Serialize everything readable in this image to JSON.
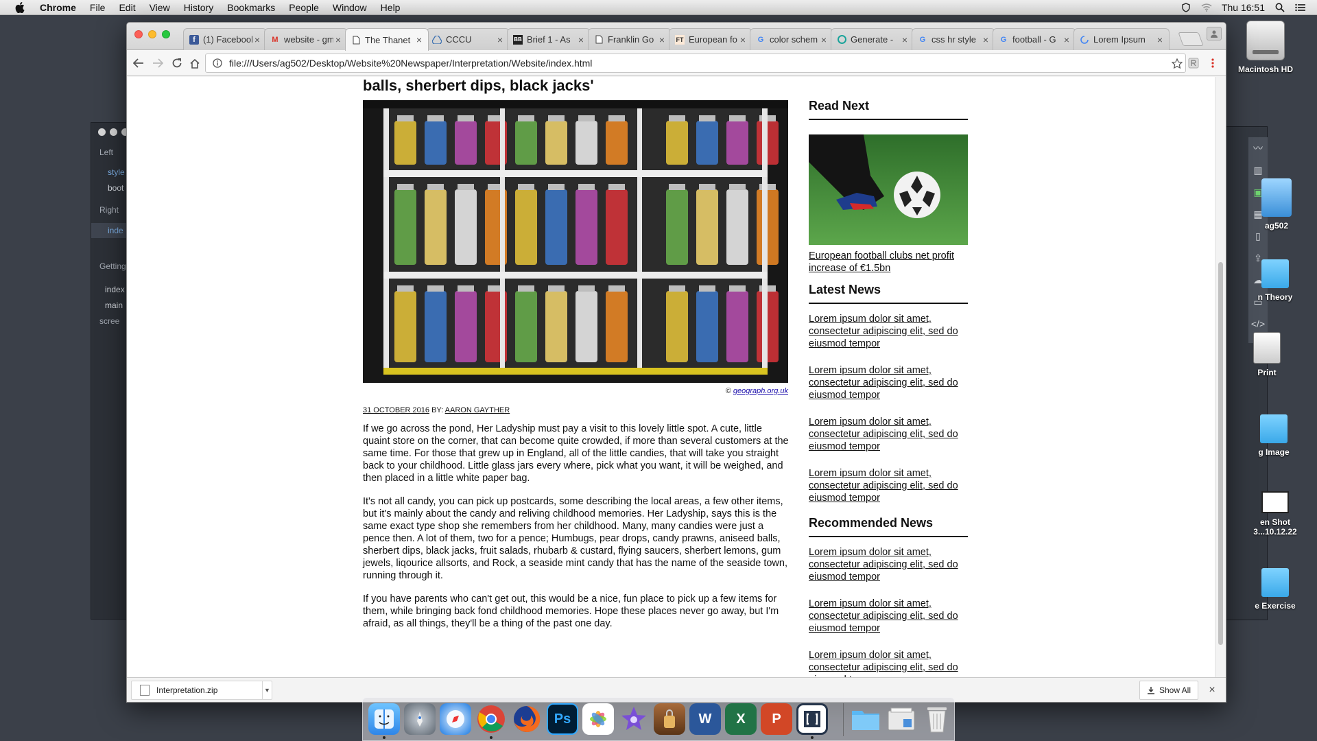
{
  "menubar": {
    "app": "Chrome",
    "items": [
      "File",
      "Edit",
      "View",
      "History",
      "Bookmarks",
      "People",
      "Window",
      "Help"
    ],
    "clock": "Thu 16:51"
  },
  "desktop": {
    "icons": [
      "Macintosh HD",
      "ag502",
      "n Theory",
      "Print",
      "g Image",
      "en Shot",
      "3...10.12.22",
      "e Exercise"
    ]
  },
  "editor": {
    "left_label": "Left",
    "left_items": [
      "style",
      "boot"
    ],
    "right_label": "Right",
    "right_item": "inde",
    "getting_label": "Getting",
    "files": [
      "index",
      "main",
      "scree"
    ]
  },
  "chrome": {
    "tabs": [
      {
        "title": "(1) Facebook",
        "icon": "facebook-icon"
      },
      {
        "title": "website - gmail",
        "icon": "gmail-icon"
      },
      {
        "title": "The Thanet",
        "icon": "page-icon"
      },
      {
        "title": "CCCU",
        "icon": "drive-icon"
      },
      {
        "title": "Brief 1 - As",
        "icon": "brief-icon"
      },
      {
        "title": "Franklin Go",
        "icon": "page-icon"
      },
      {
        "title": "European fo",
        "icon": "ft-icon"
      },
      {
        "title": "color schem",
        "icon": "google-icon"
      },
      {
        "title": "Generate - ",
        "icon": "generate-icon"
      },
      {
        "title": "css hr style",
        "icon": "google-icon"
      },
      {
        "title": "football - G",
        "icon": "google-icon"
      },
      {
        "title": "Lorem Ipsum",
        "icon": "loading-icon"
      }
    ],
    "active_tab_index": 2,
    "url": "file:///Users/ag502/Desktop/Website%20Newspaper/Interpretation/Website/index.html"
  },
  "article": {
    "headline_tail": "balls, sherbert dips, black jacks'",
    "credit_prefix": "©",
    "credit_link": "geograph.org.uk",
    "date": "31 OCTOBER 2016",
    "by_label": "BY:",
    "author": "AARON GAYTHER",
    "paragraphs": [
      "If we go across the pond, Her Ladyship must pay a visit to this lovely little spot. A cute, little quaint store on the corner, that can become quite crowded, if more than several customers at the same time. For those that grew up in England, all of the little candies, that will take you straight back to your childhood. Little glass jars every where, pick what you want, it will be weighed, and then placed in a little white paper bag.",
      "It's not all candy, you can pick up postcards, some describing the local areas, a few other items, but it's mainly about the candy and reliving childhood memories. Her Ladyship, says this is the same exact type shop she remembers from her childhood. Many, many candies were just a pence then. A lot of them, two for a pence; Humbugs, pear drops, candy prawns, aniseed balls, sherbert dips, black jacks, fruit salads, rhubarb & custard, flying saucers, sherbert lemons, gum jewels, liqourice allsorts, and Rock, a seaside mint candy that has the name of the seaside town, running through it.",
      "If you have parents who can't get out, this would be a nice, fun place to pick up a few items for them, while bringing back fond childhood memories. Hope these places never go away, but I'm afraid, as all things, they'll be a thing of the past one day."
    ]
  },
  "sidebar": {
    "read_next_heading": "Read Next",
    "read_next_link": "European football clubs net profit increase of €1.5bn",
    "latest_heading": "Latest News",
    "latest_links": [
      "Lorem ipsum dolor sit amet, consectetur adipiscing elit, sed do eiusmod tempor",
      "Lorem ipsum dolor sit amet, consectetur adipiscing elit, sed do eiusmod tempor",
      "Lorem ipsum dolor sit amet, consectetur adipiscing elit, sed do eiusmod tempor",
      "Lorem ipsum dolor sit amet, consectetur adipiscing elit, sed do eiusmod tempor"
    ],
    "recommended_heading": "Recommended News",
    "recommended_links": [
      "Lorem ipsum dolor sit amet, consectetur adipiscing elit, sed do eiusmod tempor",
      "Lorem ipsum dolor sit amet, consectetur adipiscing elit, sed do eiusmod tempor",
      "Lorem ipsum dolor sit amet, consectetur adipiscing elit, sed do eiusmod tempor"
    ]
  },
  "downloads": {
    "file": "Interpretation.zip",
    "show_all": "Show All"
  },
  "dock": {
    "apps": [
      "Finder",
      "Launchpad",
      "Safari",
      "Chrome",
      "Firefox",
      "Photoshop",
      "Photos",
      "iMovie",
      "Keychain",
      "Word",
      "Excel",
      "PowerPoint",
      "Brackets",
      "Folder",
      "Downloads",
      "Trash"
    ],
    "labels": {
      "photoshop": "Ps",
      "word": "W",
      "excel": "X",
      "powerpoint": "P"
    }
  }
}
